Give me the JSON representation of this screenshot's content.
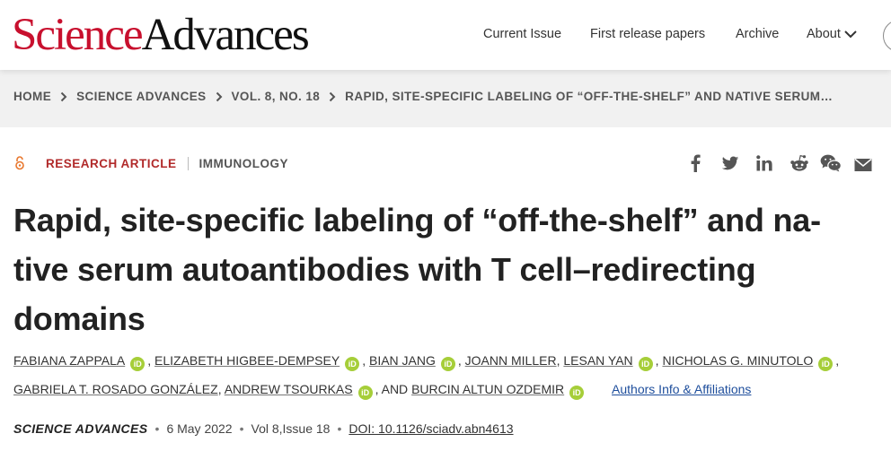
{
  "header": {
    "logo_part1": "Science",
    "logo_part2": "Advances",
    "nav": [
      {
        "label": "Current Issue"
      },
      {
        "label": "First release papers"
      },
      {
        "label": "Archive"
      },
      {
        "label": "About"
      }
    ]
  },
  "breadcrumb": [
    "HOME",
    "SCIENCE ADVANCES",
    "VOL. 8, NO. 18",
    "RAPID, SITE-SPECIFIC LABELING OF “OFF-THE-SHELF” AND NATIVE SERUM…"
  ],
  "article": {
    "type": "RESEARCH ARTICLE",
    "subject": "IMMUNOLOGY",
    "title": "Rapid, site-specific labeling of “off-the-shelf” and na-tive serum autoantibodies with T cell–redirecting domains",
    "authors": [
      "FABIANA ZAPPALA",
      "ELIZABETH HIGBEE-DEMPSEY",
      "BIAN JANG",
      "JOANN MILLER",
      "LESAN YAN",
      "NICHOLAS G. MINUTOLO",
      "GABRIELA T. ROSADO GONZÁLEZ",
      "ANDREW TSOURKAS",
      "BURCIN ALTUN OZDEMIR"
    ],
    "and_text": ", AND",
    "orcid_label": "iD",
    "affiliations_link": "Authors Info & Affiliations",
    "journal": "SCIENCE ADVANCES",
    "date": "6 May 2022",
    "volume": "Vol 8,Issue 18",
    "doi": "DOI: 10.1126/sciadv.abn4613"
  },
  "share_icons": [
    "facebook-icon",
    "twitter-icon",
    "linkedin-icon",
    "reddit-icon",
    "wechat-icon",
    "email-icon"
  ],
  "colors": {
    "brand_red": "#c8102e",
    "article_type_red": "#b12a2a",
    "orcid_green": "#a6ce39",
    "link_blue": "#1e4e9c",
    "breadcrumb_bg": "#f1f1f1"
  }
}
